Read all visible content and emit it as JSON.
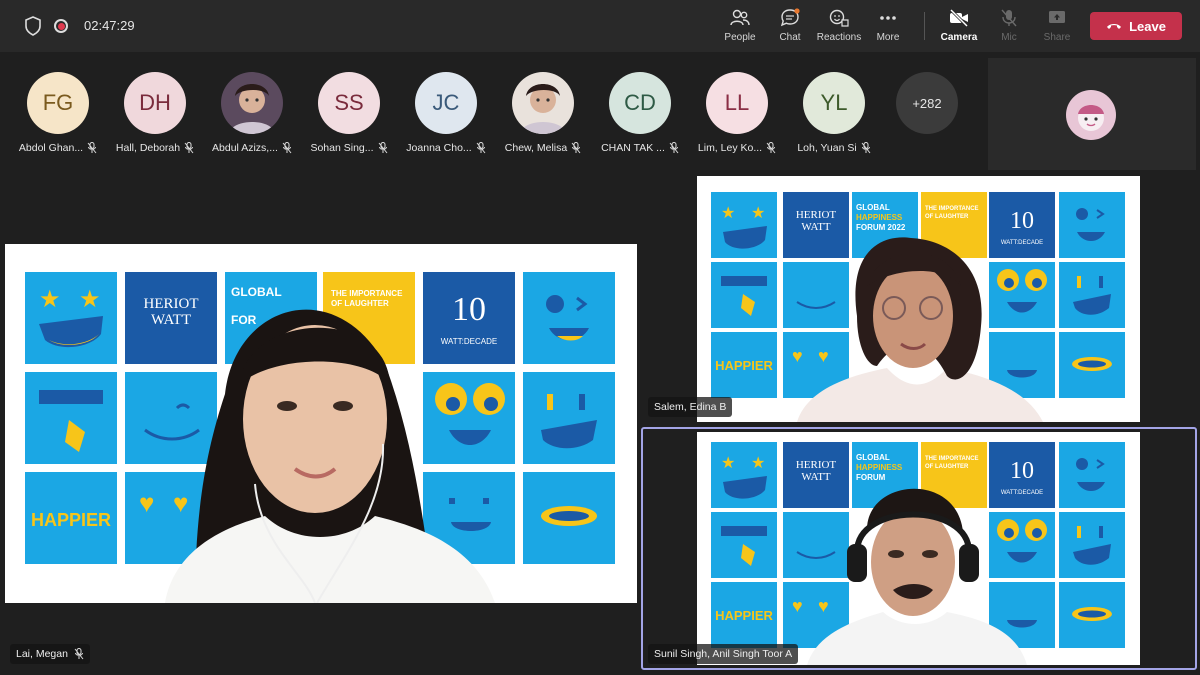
{
  "meeting": {
    "timer": "02:47:29"
  },
  "toolbar": {
    "people": "People",
    "chat": "Chat",
    "reactions": "Reactions",
    "more": "More",
    "camera": "Camera",
    "mic": "Mic",
    "share": "Share",
    "leave": "Leave"
  },
  "participants": [
    {
      "initials": "FG",
      "name": "Abdol Ghan...",
      "bg": "#f6e5c8",
      "fg": "#7a5a1e"
    },
    {
      "initials": "DH",
      "name": "Hall, Deborah",
      "bg": "#f0d8dc",
      "fg": "#7a2b3c"
    },
    {
      "initials": "",
      "name": "Abdul Azizs,...",
      "bg": "#5b4a5e",
      "fg": "#fff"
    },
    {
      "initials": "SS",
      "name": "Sohan Sing...",
      "bg": "#f2dde1",
      "fg": "#7a2b3c"
    },
    {
      "initials": "JC",
      "name": "Joanna Cho...",
      "bg": "#dfe7ef",
      "fg": "#3a5a7a"
    },
    {
      "initials": "",
      "name": "Chew, Melisa",
      "bg": "#e9e2dc",
      "fg": "#333"
    },
    {
      "initials": "CD",
      "name": "CHAN TAK ...",
      "bg": "#d6e5de",
      "fg": "#2e5a45"
    },
    {
      "initials": "LL",
      "name": "Lim, Ley Ko...",
      "bg": "#f6dfe3",
      "fg": "#8a2e45"
    },
    {
      "initials": "YL",
      "name": "Loh, Yuan Si",
      "bg": "#e1e9da",
      "fg": "#3d5a2a"
    }
  ],
  "overflow_count": "+282",
  "videos": {
    "main": {
      "name": "Lai, Megan"
    },
    "top_right": {
      "name": "Salem, Edina B"
    },
    "bottom_right": {
      "name": "Sunil Singh, Anil Singh Toor A"
    }
  },
  "slide": {
    "brand1": "HERIOT",
    "brand2": "WATT",
    "global": "GLOBAL",
    "happiness": "HAPPINESS",
    "forum": "FORUM",
    "importance": "THE IMPORTANCE",
    "laughter": "OF LAUGHTER",
    "decade_num": "10",
    "decade": "WATT:DECADE",
    "happier": "HAPPIER"
  },
  "colors": {
    "accent_blue": "#1ba7e4",
    "yellow": "#f7c519",
    "navy": "#1b5aa6",
    "leave_red": "#c4314b",
    "active_border": "#a3a4e6"
  }
}
